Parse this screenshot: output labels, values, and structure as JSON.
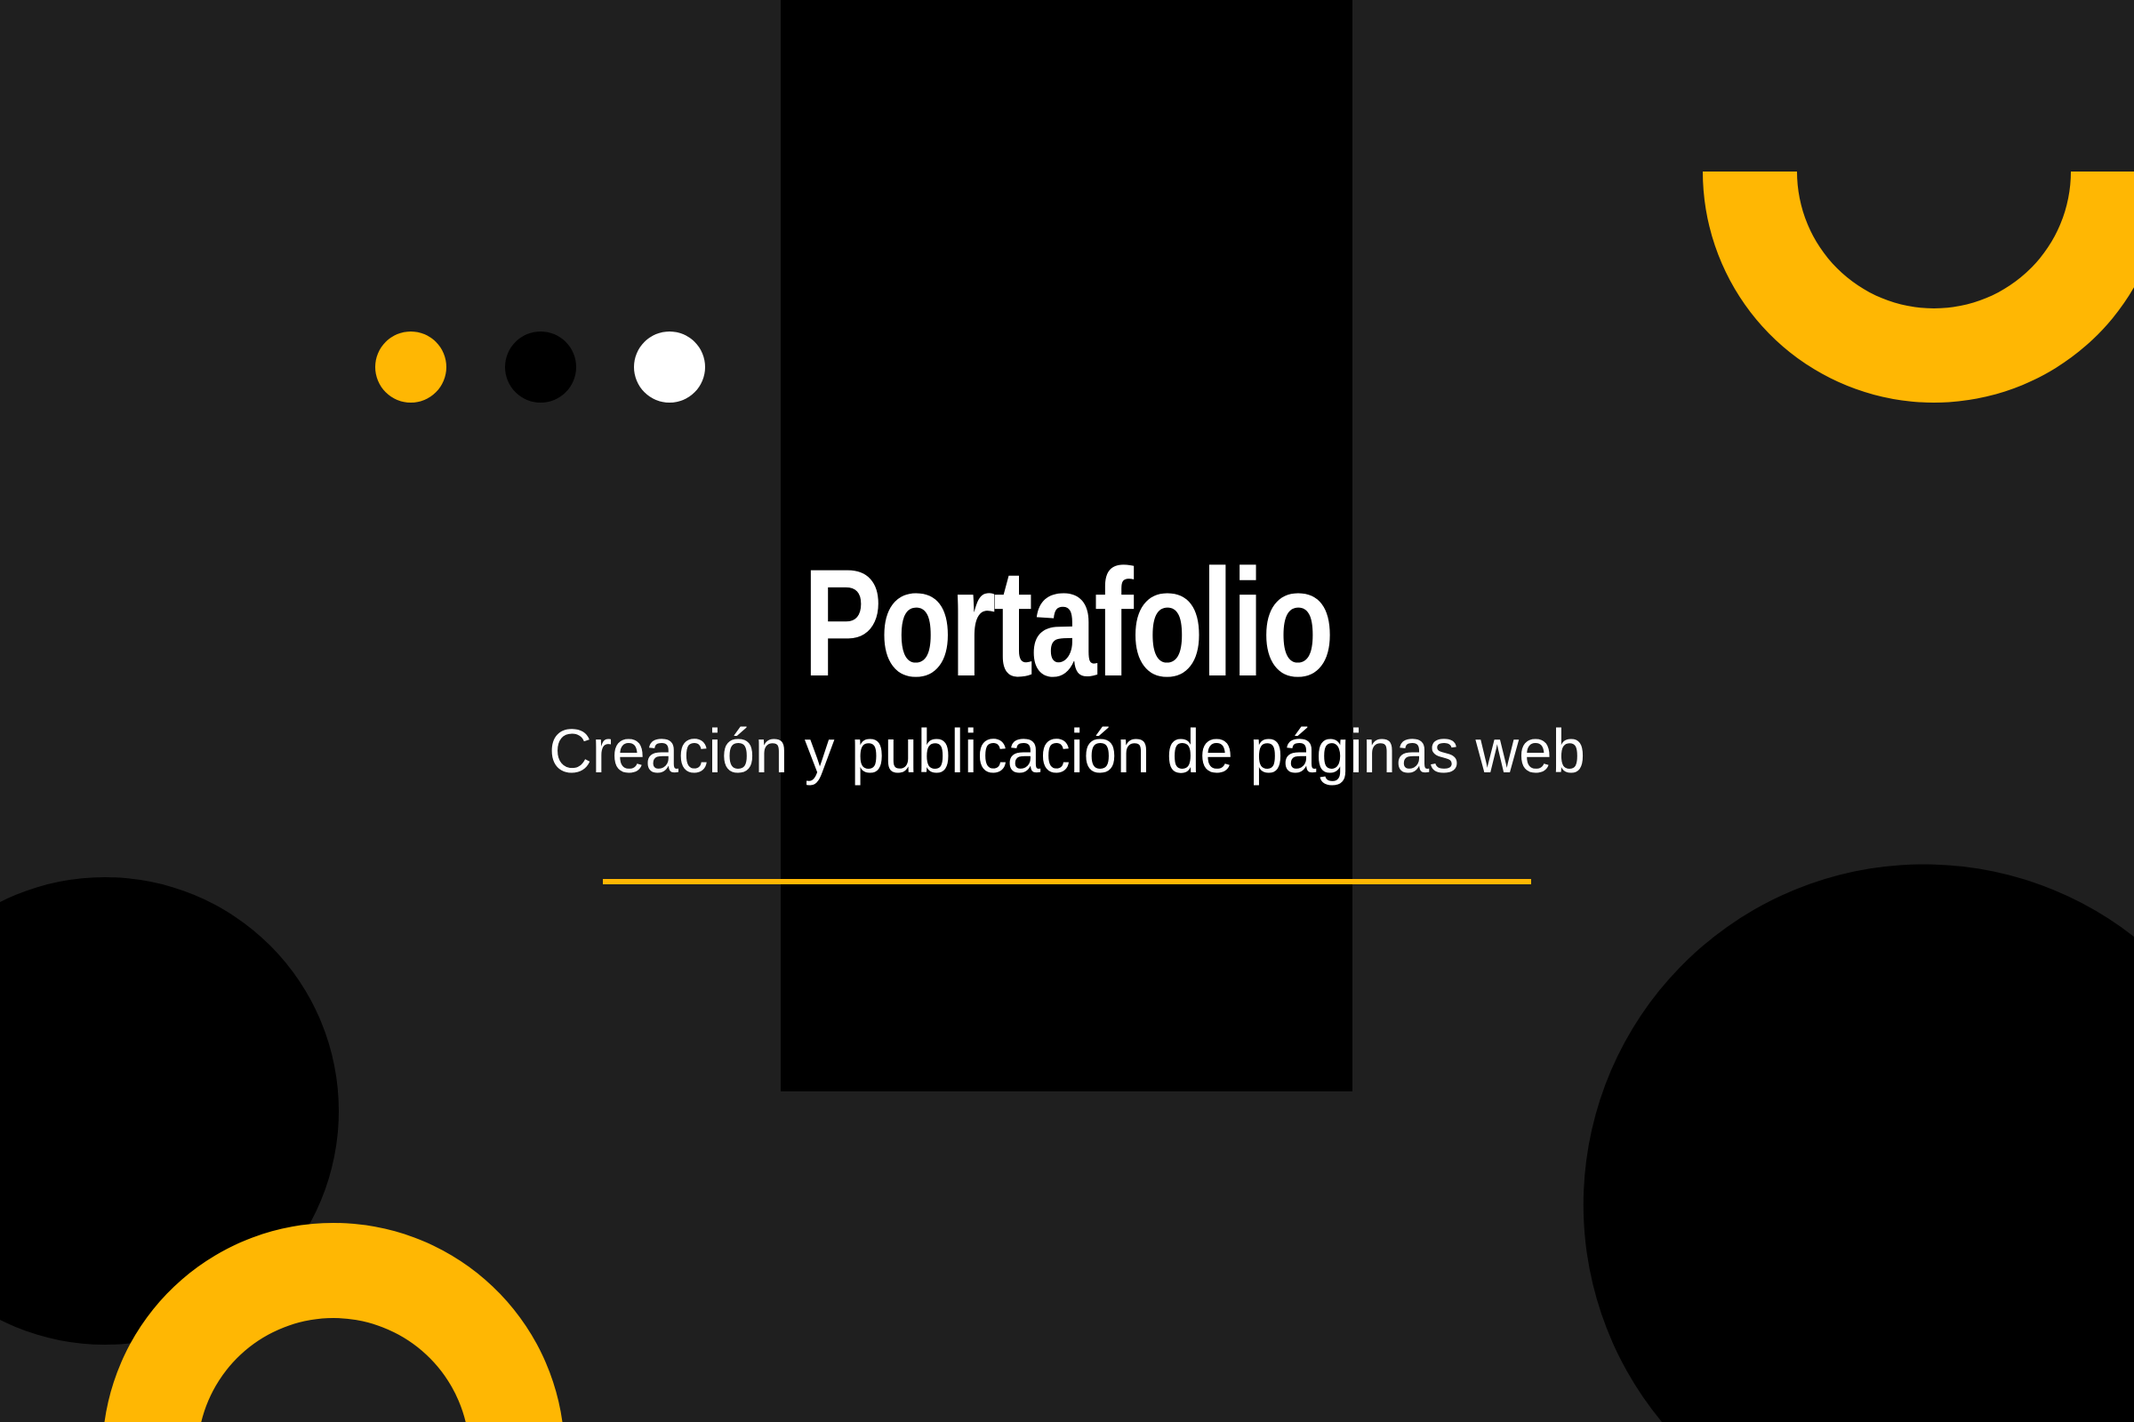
{
  "colors": {
    "background": "#1f1f1f",
    "panel": "#000000",
    "accent": "#ffb703",
    "text": "#ffffff"
  },
  "dots": [
    {
      "color": "#ffb703"
    },
    {
      "color": "#000000"
    },
    {
      "color": "#ffffff"
    }
  ],
  "hero": {
    "title": "Portafolio",
    "subtitle": "Creación y publicación de páginas web"
  }
}
